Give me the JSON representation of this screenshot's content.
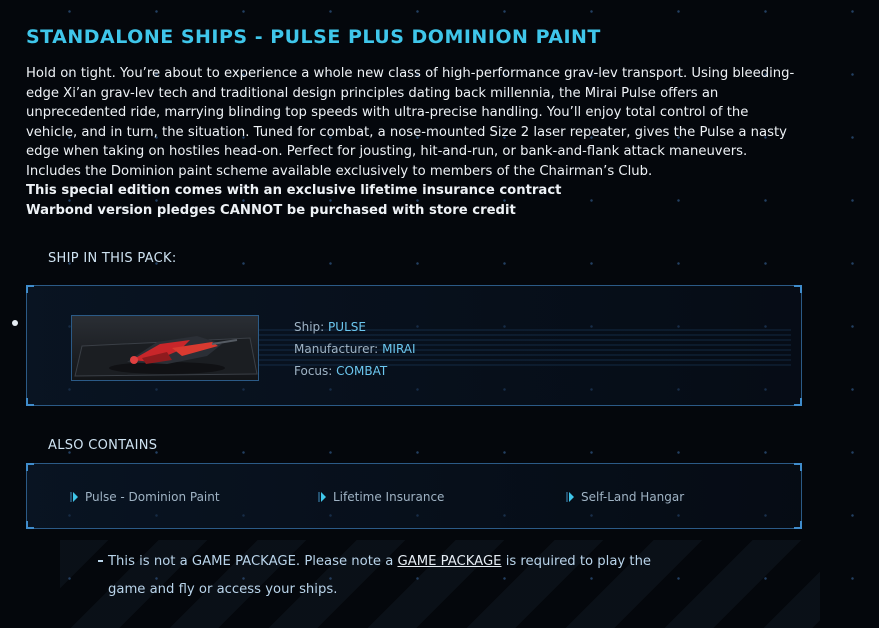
{
  "page": {
    "title": "STANDALONE SHIPS - PULSE PLUS DOMINION PAINT",
    "description": "Hold on tight. You’re about to experience a whole new class of high-performance grav-lev transport. Using bleeding-edge Xi’an grav-lev tech and traditional design principles dating back millennia, the Mirai Pulse offers an unprecedented ride, marrying blinding top speeds with ultra-precise handling. You’ll enjoy total control of the vehicle, and in turn, the situation. Tuned for combat, a nose-mounted Size 2 laser repeater, gives the Pulse a nasty edge when taking on hostiles head-on. Perfect for jousting, hit-and-run, or bank-and-flank attack maneuvers. Includes the Dominion paint scheme available exclusively to members of the Chairman’s Club.",
    "note_insurance": "This special edition comes with an exclusive lifetime insurance contract",
    "note_warbond": "Warbond version pledges CANNOT be purchased with store credit"
  },
  "ship_section": {
    "label": "SHIP IN THIS PACK:",
    "ship_label": "Ship:",
    "ship_value": "PULSE",
    "manufacturer_label": "Manufacturer:",
    "manufacturer_value": "MIRAI",
    "focus_label": "Focus:",
    "focus_value": "COMBAT"
  },
  "also_contains": {
    "label": "ALSO CONTAINS",
    "items": [
      "Pulse - Dominion Paint",
      "Lifetime Insurance",
      "Self-Land Hangar"
    ]
  },
  "notice": {
    "prefix": "This is not a GAME PACKAGE. Please note a ",
    "link": "GAME PACKAGE",
    "suffix": " is required to play the game and fly or access your ships."
  },
  "colors": {
    "accent": "#3fc6ea",
    "value": "#6cc7ef",
    "border": "#2b5a86",
    "background": "#04070c"
  }
}
